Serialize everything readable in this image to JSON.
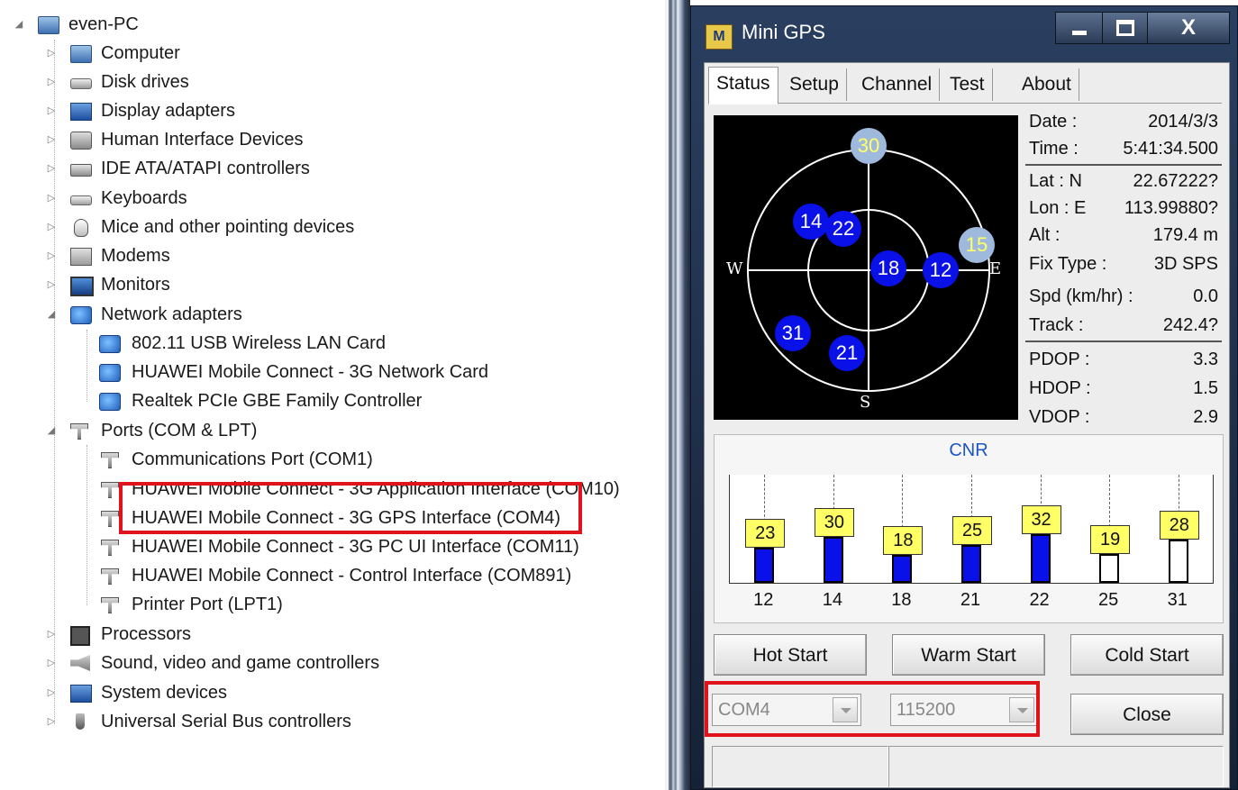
{
  "device_manager": {
    "root": "even-PC",
    "categories": [
      {
        "label": "Computer"
      },
      {
        "label": "Disk drives"
      },
      {
        "label": "Display adapters"
      },
      {
        "label": "Human Interface Devices"
      },
      {
        "label": "IDE ATA/ATAPI controllers"
      },
      {
        "label": "Keyboards"
      },
      {
        "label": "Mice and other pointing devices"
      },
      {
        "label": "Modems"
      },
      {
        "label": "Monitors"
      },
      {
        "label": "Network adapters"
      },
      {
        "label": "Ports (COM & LPT)"
      },
      {
        "label": "Processors"
      },
      {
        "label": "Sound, video and game controllers"
      },
      {
        "label": "System devices"
      },
      {
        "label": "Universal Serial Bus controllers"
      }
    ],
    "network_adapters": [
      "802.11 USB Wireless LAN Card",
      "HUAWEI Mobile Connect - 3G Network Card",
      "Realtek PCIe GBE Family Controller"
    ],
    "ports": [
      "Communications Port (COM1)",
      "HUAWEI Mobile Connect - 3G Application Interface (COM10)",
      "HUAWEI Mobile Connect - 3G GPS Interface (COM4)",
      "HUAWEI Mobile Connect - 3G PC UI Interface (COM11)",
      "HUAWEI Mobile Connect - Control Interface (COM891)",
      "Printer Port (LPT1)"
    ]
  },
  "gps": {
    "icon_text": "M",
    "title": "Mini GPS",
    "close_glyph": "X",
    "tabs": [
      "Status",
      "Setup",
      "Channel",
      "Test",
      "About"
    ],
    "directions": {
      "n": "",
      "s": "S",
      "w": "W",
      "e": "E"
    },
    "satellites": [
      {
        "prn": "30",
        "fix": false
      },
      {
        "prn": "14",
        "fix": true
      },
      {
        "prn": "22",
        "fix": true
      },
      {
        "prn": "15",
        "fix": false
      },
      {
        "prn": "18",
        "fix": true
      },
      {
        "prn": "12",
        "fix": true
      },
      {
        "prn": "31",
        "fix": true
      },
      {
        "prn": "21",
        "fix": true
      }
    ],
    "info": {
      "date_label": "Date :",
      "date": "2014/3/3",
      "time_label": "Time :",
      "time": "5:41:34.500",
      "lat_label": "Lat  : N",
      "lat": "22.67222?",
      "lon_label": "Lon  : E",
      "lon": "113.99880?",
      "alt_label": "Alt   :",
      "alt": "179.4 m",
      "fix_label": "Fix Type :",
      "fix": "3D SPS",
      "spd_label": "Spd (km/hr) :",
      "spd": "0.0",
      "track_label": "Track  :",
      "track": "242.4?",
      "pdop_label": "PDOP :",
      "pdop": "3.3",
      "hdop_label": "HDOP :",
      "hdop": "1.5",
      "vdop_label": "VDOP :",
      "vdop": "2.9"
    },
    "cnr_title": "CNR",
    "buttons": {
      "hot": "Hot Start",
      "warm": "Warm Start",
      "cold": "Cold Start",
      "close": "Close"
    },
    "port": "COM4",
    "baud": "115200"
  },
  "chart_data": {
    "type": "bar",
    "title": "CNR",
    "categories": [
      "12",
      "14",
      "18",
      "21",
      "22",
      "25",
      "31"
    ],
    "values": [
      23,
      30,
      18,
      25,
      32,
      19,
      28
    ],
    "used_in_fix": [
      true,
      true,
      true,
      true,
      true,
      false,
      false
    ],
    "ylim": [
      0,
      60
    ],
    "colors": {
      "used": "#0a10e8",
      "unused": "#ffffff",
      "label_bg": "#ffff66"
    }
  }
}
